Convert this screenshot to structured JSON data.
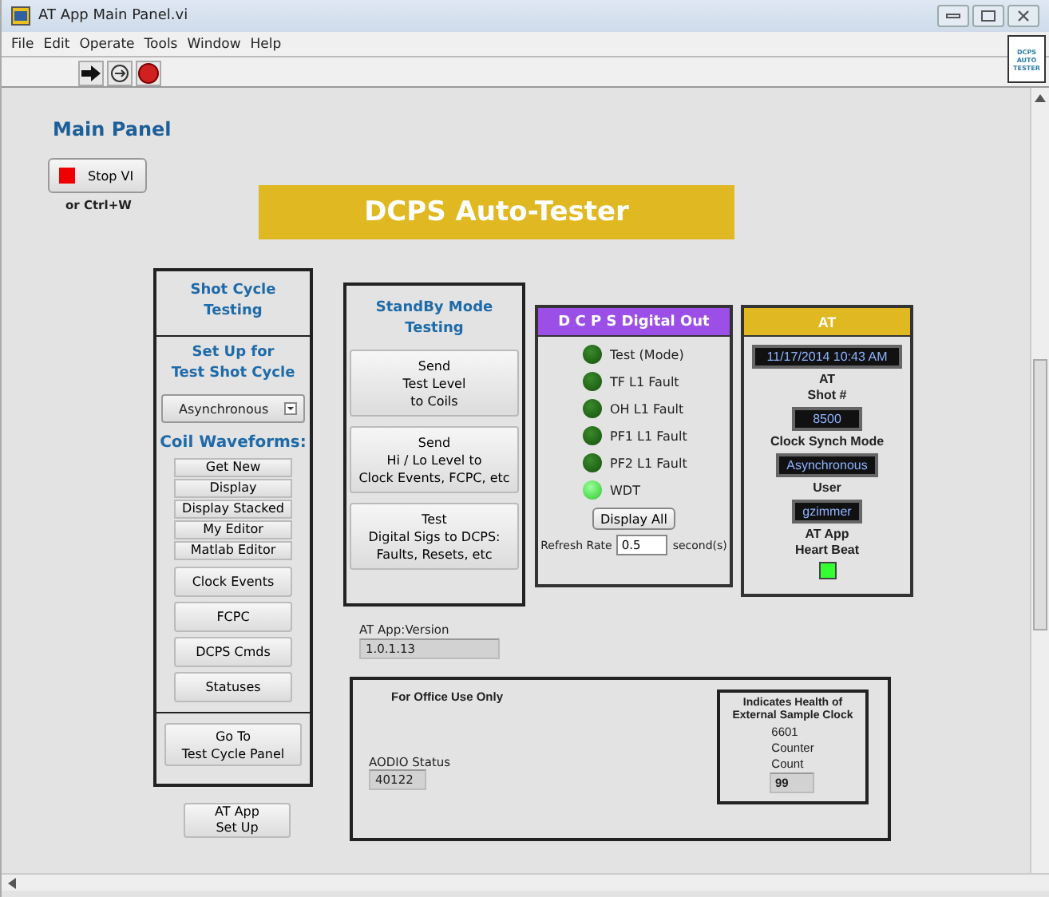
{
  "window": {
    "title": "AT App Main Panel.vi"
  },
  "menu": [
    "File",
    "Edit",
    "Operate",
    "Tools",
    "Window",
    "Help"
  ],
  "vi_icon": [
    "DCPS",
    "AUTO",
    "TESTER"
  ],
  "panel_title": "Main Panel",
  "stop_button": {
    "label": "Stop VI",
    "hint": "or Ctrl+W"
  },
  "banner": "DCPS Auto-Tester",
  "shot_cycle": {
    "title": "Shot Cycle\nTesting",
    "setup_title": "Set Up for\nTest Shot Cycle",
    "mode": "Asynchronous",
    "waveforms_title": "Coil Waveforms:",
    "waveform_buttons": [
      "Get New",
      "Display",
      "Display Stacked",
      "My Editor",
      "Matlab Editor"
    ],
    "buttons": [
      "Clock Events",
      "FCPC",
      "DCPS Cmds",
      "Statuses"
    ],
    "goto_button": "Go To\nTest Cycle Panel"
  },
  "setup_button": "AT App\nSet Up",
  "standby": {
    "title": "StandBy Mode\nTesting",
    "buttons": [
      "Send\nTest Level\nto Coils",
      "Send\nHi / Lo Level to\nClock Events, FCPC, etc",
      "Test\nDigital Sigs to DCPS:\nFaults, Resets, etc"
    ]
  },
  "digital_out": {
    "title": "D C P S Digital Out",
    "leds": [
      {
        "label": "Test (Mode)",
        "on": false
      },
      {
        "label": "TF L1 Fault",
        "on": false
      },
      {
        "label": "OH L1 Fault",
        "on": false
      },
      {
        "label": "PF1 L1 Fault",
        "on": false
      },
      {
        "label": "PF2 L1 Fault",
        "on": false
      },
      {
        "label": "WDT",
        "on": true
      }
    ],
    "display_button": "Display All",
    "refresh_label": "Refresh Rate",
    "refresh_value": "0.5",
    "refresh_unit": "second(s)"
  },
  "at": {
    "title": "AT",
    "datetime": "11/17/2014 10:43 AM",
    "shot_label": "AT\nShot #",
    "shot": "8500",
    "clock_label": "Clock Synch Mode",
    "clock": "Asynchronous",
    "user_label": "User",
    "user": "gzimmer",
    "heartbeat_label": "AT App\nHeart Beat",
    "heartbeat_on": true
  },
  "version": {
    "label": "AT App:Version",
    "value": "1.0.1.13"
  },
  "office": {
    "title": "For Office Use Only",
    "aodio_label": "AODIO Status",
    "aodio": "40122",
    "health_title": "Indicates Health of\nExternal Sample Clock",
    "counter_label": "6601\nCounter\nCount",
    "counter": "99"
  }
}
